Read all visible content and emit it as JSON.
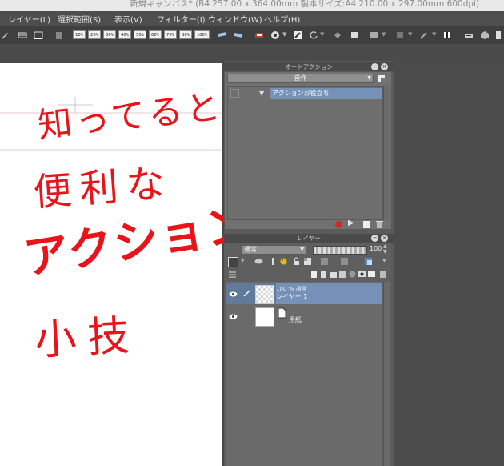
{
  "window": {
    "title": "新規キャンバス* (B4 257.00 x 364.00mm 製本サイズ:A4 210.00 x 297.00mm 600dpi)"
  },
  "menu": {
    "items": [
      "レイヤー(L)",
      "選択範囲(S)",
      "表示(V)",
      "フィルター(I)",
      "ウィンドウ(W)",
      "ヘルプ(H)"
    ]
  },
  "toolbar": {
    "zoom_buttons": [
      "10%",
      "20%",
      "30%",
      "40%",
      "50%",
      "60%",
      "70%",
      "80%",
      "100%"
    ]
  },
  "canvas": {
    "handwriting": {
      "line1": "知ってると",
      "line2": "便利な",
      "line3": "アクション",
      "line4": "小技"
    },
    "colors": {
      "ink": "#e8141a",
      "paper": "#ffffff"
    }
  },
  "auto_action": {
    "title": "オートアクション",
    "set_name": "自作",
    "items": [
      {
        "label": "アクションお役立ち"
      }
    ]
  },
  "layer": {
    "title": "レイヤー",
    "blend_mode": "通常",
    "opacity": "100",
    "layers": [
      {
        "info": "100 % 通常",
        "name": "レイヤー 1"
      },
      {
        "info": "",
        "name": "用紙"
      }
    ]
  },
  "colors": {
    "selection": "#7591b8",
    "record": "#d7262b"
  }
}
